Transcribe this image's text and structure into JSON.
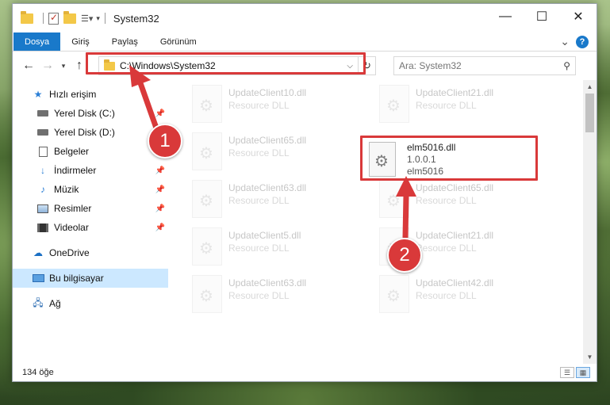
{
  "window": {
    "title": "System32",
    "controls": {
      "minimize": "—",
      "maximize": "☐",
      "close": "✕"
    }
  },
  "ribbon": {
    "tabs": [
      "Dosya",
      "Giriş",
      "Paylaş",
      "Görünüm"
    ],
    "expand_glyph": "⌄",
    "help_glyph": "?"
  },
  "address": {
    "path": "C:\\Windows\\System32",
    "search_placeholder": "Ara: System32"
  },
  "sidebar": {
    "items": [
      {
        "label": "Hızlı erişim",
        "icon": "star-icon",
        "pinned": false
      },
      {
        "label": "Yerel Disk (C:)",
        "icon": "drive-icon",
        "pinned": true
      },
      {
        "label": "Yerel Disk (D:)",
        "icon": "drive-icon",
        "pinned": false
      },
      {
        "label": "Belgeler",
        "icon": "document-icon",
        "pinned": true
      },
      {
        "label": "İndirmeler",
        "icon": "download-icon",
        "pinned": true
      },
      {
        "label": "Müzik",
        "icon": "music-icon",
        "pinned": true
      },
      {
        "label": "Resimler",
        "icon": "pictures-icon",
        "pinned": true
      },
      {
        "label": "Videolar",
        "icon": "video-icon",
        "pinned": true
      },
      {
        "label": "OneDrive",
        "icon": "onedrive-icon",
        "pinned": false
      },
      {
        "label": "Bu bilgisayar",
        "icon": "computer-icon",
        "pinned": false,
        "selected": true
      },
      {
        "label": "Ağ",
        "icon": "network-icon",
        "pinned": false
      }
    ]
  },
  "files": {
    "left_column": [
      {
        "name": "UpdateClient10.dll",
        "type": "Resource DLL"
      },
      {
        "name": "UpdateClient65.dll",
        "type": "Resource DLL"
      },
      {
        "name": "UpdateClient63.dll",
        "type": "Resource DLL"
      },
      {
        "name": "UpdateClient5.dll",
        "type": "Resource DLL"
      },
      {
        "name": "UpdateClient63.dll",
        "type": "Resource DLL"
      }
    ],
    "right_column": [
      {
        "name": "UpdateClient21.dll",
        "type": "Resource DLL"
      },
      {
        "name": "UpdateClient65.dll",
        "type": "Resource DLL"
      },
      {
        "name": "UpdateClient21.dll",
        "type": "Resource DLL"
      },
      {
        "name": "UpdateClient42.dll",
        "type": "Resource DLL"
      }
    ],
    "highlighted": {
      "name": "elm5016.dll",
      "version": "1.0.0.1",
      "description": "elm5016"
    }
  },
  "status": {
    "item_count": "134 öğe"
  },
  "annotations": {
    "step1": "1",
    "step2": "2",
    "color": "#d9393a"
  }
}
